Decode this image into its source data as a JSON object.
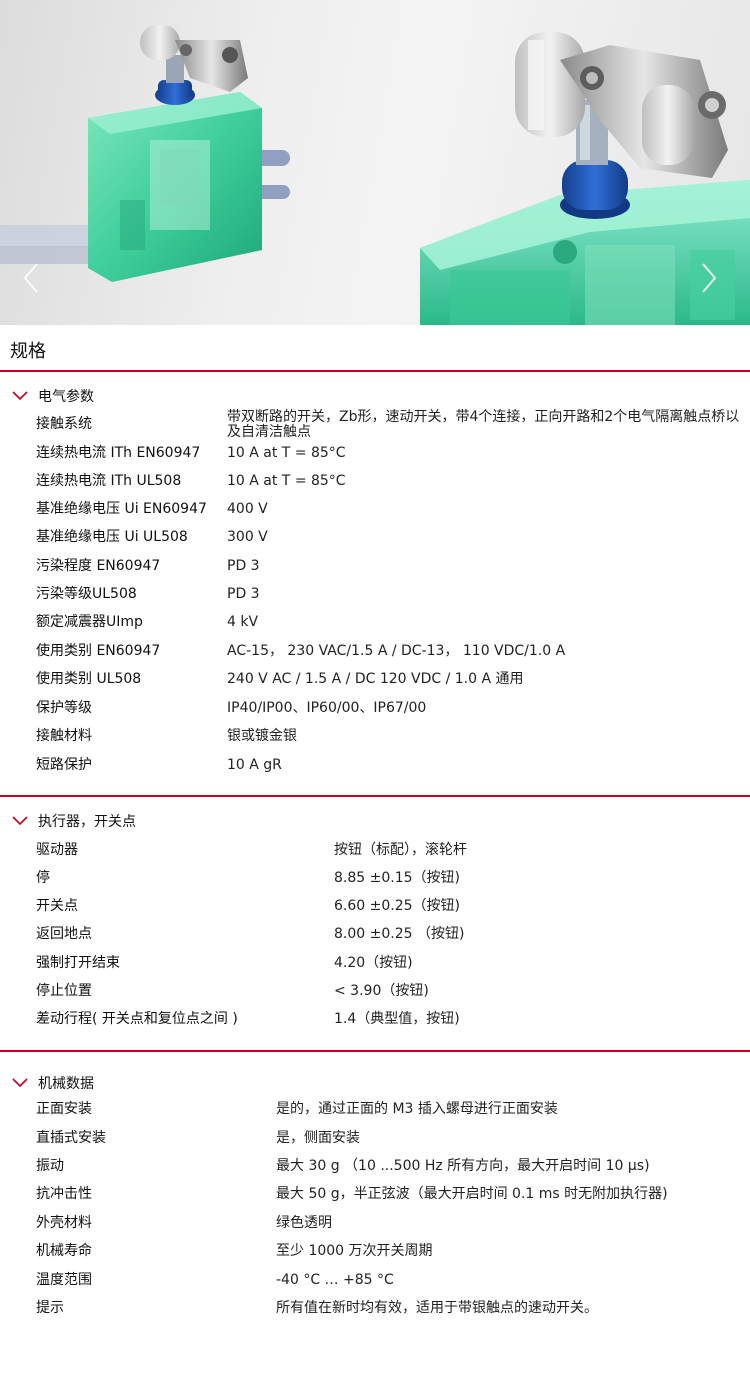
{
  "hero": {
    "prev_icon": "chevron-left-icon",
    "next_icon": "chevron-right-icon"
  },
  "page_title": "规格",
  "sections": [
    {
      "title": "电气参数",
      "rows": [
        {
          "label": "接触系统",
          "value": "带双断路的开关，Zb形，速动开关，带4个连接，正向开路和2个电气隔离触点桥以及自清洁触点"
        },
        {
          "label": "连续热电流 ITh EN60947",
          "value": "10 A at T = 85°C"
        },
        {
          "label": "连续热电流 ITh UL508",
          "value": "10 A at T = 85°C"
        },
        {
          "label": "基准绝缘电压 Ui EN60947",
          "value": "400 V"
        },
        {
          "label": "基准绝缘电压 Ui UL508",
          "value": "300 V"
        },
        {
          "label": "污染程度 EN60947",
          "value": "PD 3"
        },
        {
          "label": "污染等级UL508",
          "value": "PD 3"
        },
        {
          "label": "额定减震器UImp",
          "value": "4 kV"
        },
        {
          "label": "使用类别 EN60947",
          "value": "AC-15， 230 VAC/1.5 A / DC-13， 110 VDC/1.0 A"
        },
        {
          "label": "使用类别 UL508",
          "value": "240 V AC / 1.5 A / DC 120 VDC / 1.0 A 通用"
        },
        {
          "label": "保护等级",
          "value": "IP40/IP00、IP60/00、IP67/00"
        },
        {
          "label": "接触材料",
          "value": "银或镀金银"
        },
        {
          "label": "短路保护",
          "value": "10 A gR"
        }
      ]
    },
    {
      "title": "执行器，开关点",
      "rows": [
        {
          "label": "驱动器",
          "value": "按钮（标配），滚轮杆"
        },
        {
          "label": "停",
          "value": "8.85 ±0.15（按钮)"
        },
        {
          "label": "开关点",
          "value": "6.60 ±0.25（按钮)"
        },
        {
          "label": "返回地点",
          "value": "8.00 ±0.25 （按钮)"
        },
        {
          "label": "强制打开结束",
          "value": "4.20（按钮)"
        },
        {
          "label": "停止位置",
          "value": "< 3.90（按钮)"
        },
        {
          "label": "差动行程( 开关点和复位点之间 )",
          "value": "1.4（典型值，按钮)"
        }
      ]
    },
    {
      "title": "机械数据",
      "rows": [
        {
          "label": "正面安装",
          "value": "是的，通过正面的 M3 插入螺母进行正面安装"
        },
        {
          "label": "直插式安装",
          "value": "是，侧面安装"
        },
        {
          "label": "振动",
          "value": "最大 30 g （10 ...500 Hz 所有方向，最大开启时间 10 µs)"
        },
        {
          "label": "抗冲击性",
          "value": "最大 50 g，半正弦波（最大开启时间 0.1 ms 时无附加执行器)"
        },
        {
          "label": "外壳材料",
          "value": "绿色透明"
        },
        {
          "label": "机械寿命",
          "value": "至少 1000 万次开关周期"
        },
        {
          "label": "温度范围",
          "value": "-40 °C … +85 °C"
        },
        {
          "label": "提示",
          "value": "所有值在新时均有效，适用于带银触点的速动开关。"
        }
      ]
    }
  ],
  "colors": {
    "accent": "#c8001e",
    "housing_green": "#2fc99a",
    "plunger_blue": "#1f55b5"
  }
}
